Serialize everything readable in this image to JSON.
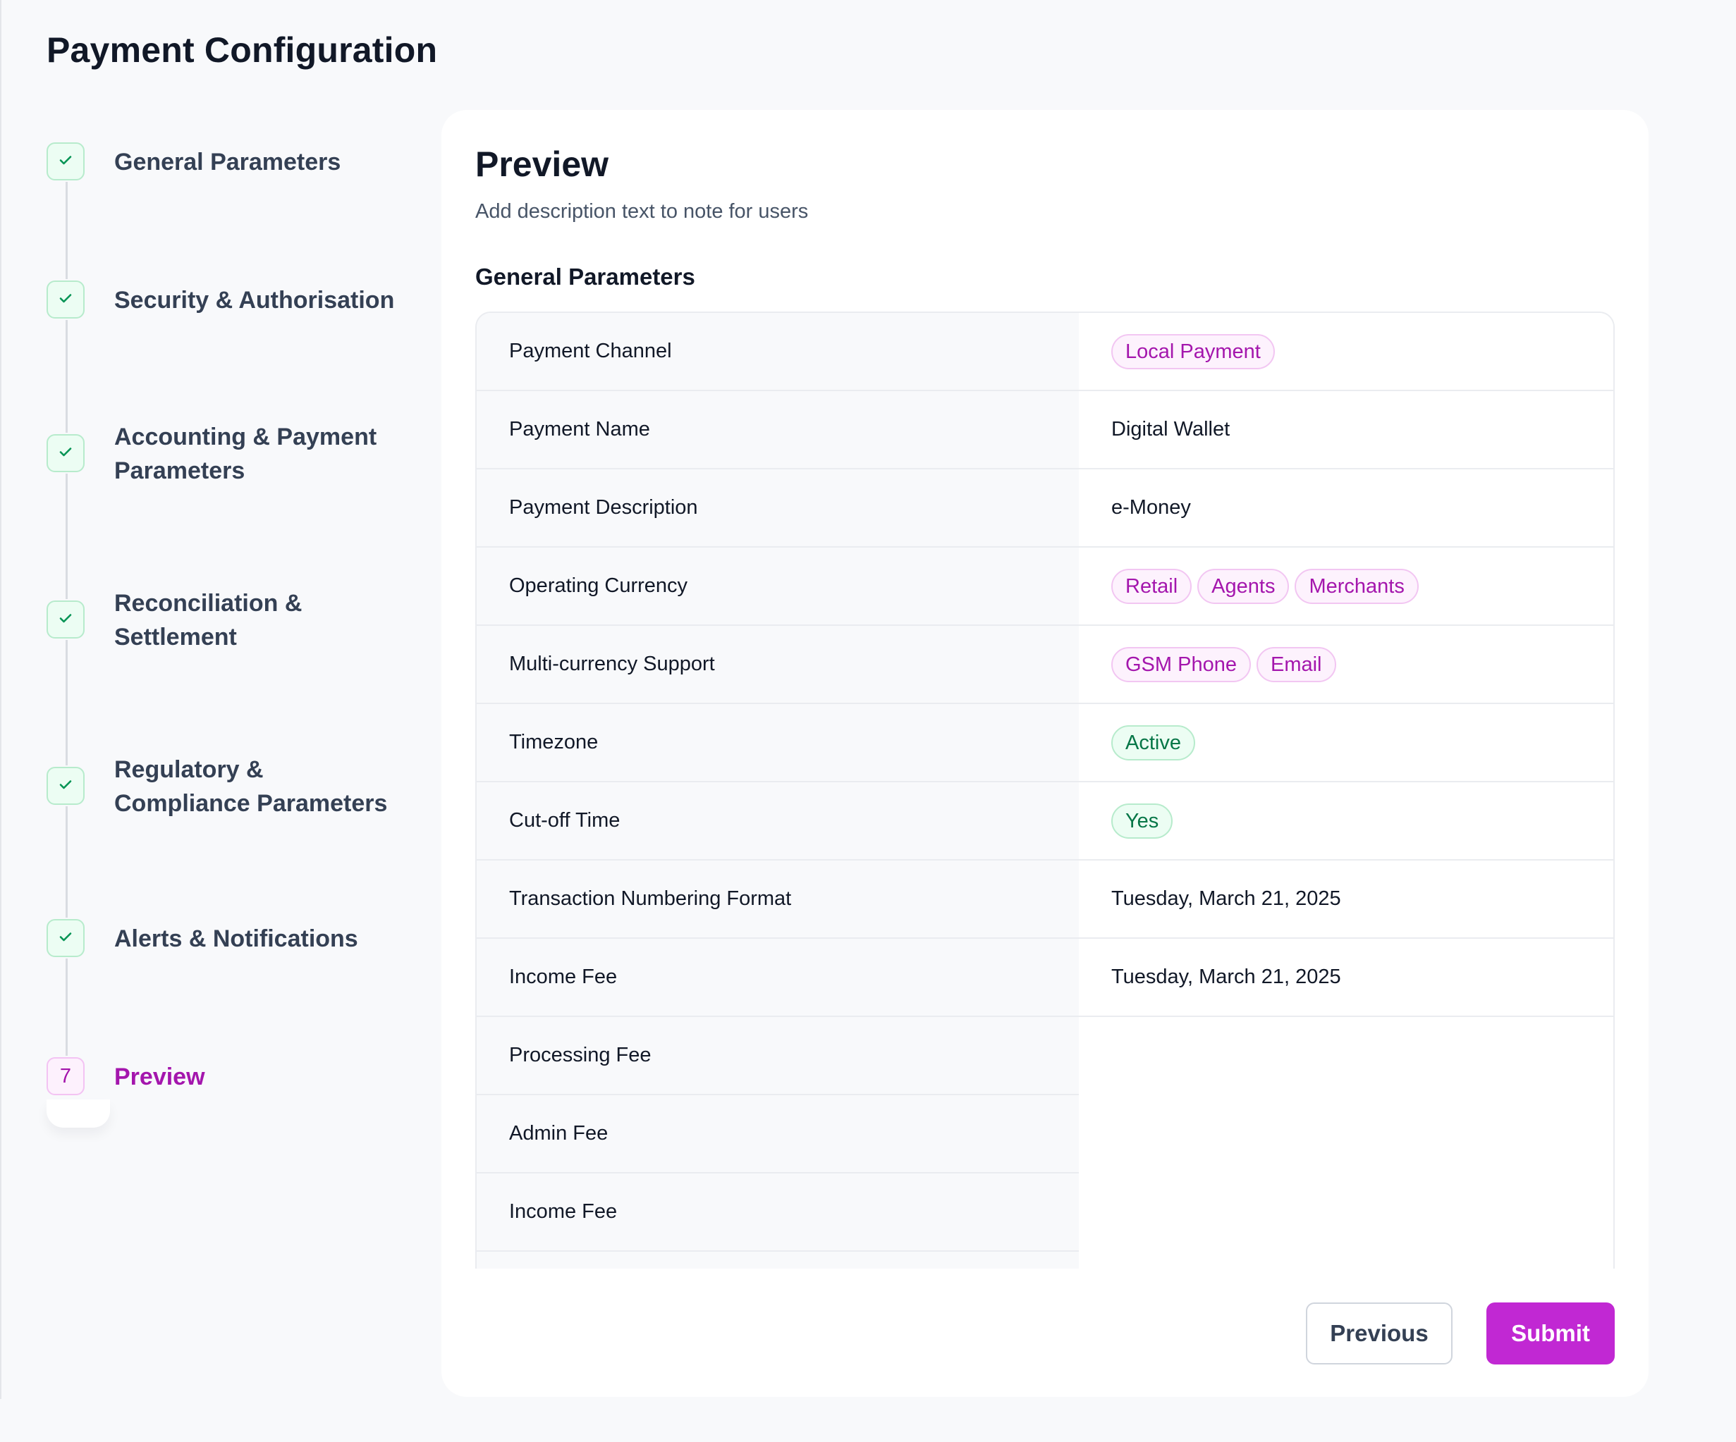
{
  "page": {
    "title": "Payment Configuration"
  },
  "stepper": {
    "steps": [
      {
        "label": "General Parameters",
        "status": "completed"
      },
      {
        "label": "Security & Authorisation",
        "status": "completed"
      },
      {
        "label": "Accounting & Payment\nParameters",
        "status": "completed"
      },
      {
        "label": "Reconciliation &\nSettlement",
        "status": "completed"
      },
      {
        "label": "Regulatory &\nCompliance Parameters",
        "status": "completed"
      },
      {
        "label": "Alerts & Notifications",
        "status": "completed"
      },
      {
        "label": "Preview",
        "status": "current",
        "number": "7"
      }
    ],
    "check_icon": "check-icon"
  },
  "preview": {
    "title": "Preview",
    "description": "Add description text to note for users",
    "section_title": "General Parameters",
    "rows": [
      {
        "key": "Payment Channel",
        "chips": [
          {
            "text": "Local Payment",
            "tone": "purple"
          }
        ]
      },
      {
        "key": "Payment Name",
        "value": "Digital Wallet"
      },
      {
        "key": "Payment Description",
        "value": "e-Money"
      },
      {
        "key": "Operating Currency",
        "chips": [
          {
            "text": "Retail",
            "tone": "purple"
          },
          {
            "text": "Agents",
            "tone": "purple"
          },
          {
            "text": "Merchants",
            "tone": "purple"
          }
        ]
      },
      {
        "key": "Multi-currency Support",
        "chips": [
          {
            "text": "GSM Phone",
            "tone": "purple"
          },
          {
            "text": "Email",
            "tone": "purple"
          }
        ]
      },
      {
        "key": "Timezone",
        "chips": [
          {
            "text": "Active",
            "tone": "green"
          }
        ]
      },
      {
        "key": "Cut-off Time",
        "chips": [
          {
            "text": "Yes",
            "tone": "green"
          }
        ]
      },
      {
        "key": "Transaction Numbering Format",
        "value": "Tuesday, March 21, 2025"
      },
      {
        "key": "Income Fee",
        "value": "Tuesday, March 21, 2025"
      },
      {
        "key": "Processing Fee",
        "value": ""
      },
      {
        "key": "Admin Fee",
        "value": ""
      },
      {
        "key": "Income Fee",
        "value": ""
      },
      {
        "key": "",
        "value": ""
      }
    ]
  },
  "actions": {
    "previous_label": "Previous",
    "submit_label": "Submit"
  },
  "colors": {
    "brand": "#c128d3",
    "brand_text": "#a416ad",
    "success": "#067647",
    "background": "#f8f9fb"
  }
}
